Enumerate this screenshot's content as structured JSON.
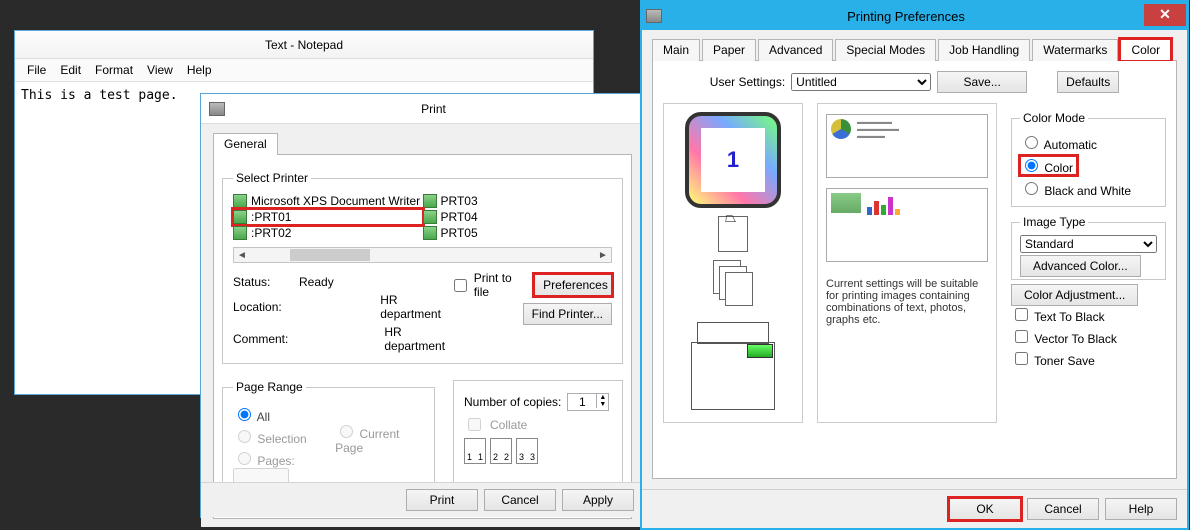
{
  "notepad": {
    "title": "Text - Notepad",
    "menu": {
      "file": "File",
      "edit": "Edit",
      "format": "Format",
      "view": "View",
      "help": "Help"
    },
    "body": "This is a test page."
  },
  "print": {
    "title": "Print",
    "tab_general": "General",
    "select_printer": "Select Printer",
    "printers": [
      "Microsoft XPS Document Writer",
      ":PRT01",
      ":PRT02",
      "PRT03",
      "PRT04",
      "PRT05"
    ],
    "status_label": "Status:",
    "status_value": "Ready",
    "location_label": "Location:",
    "location_value": "HR department",
    "comment_label": "Comment:",
    "comment_value": "HR department",
    "print_to_file": "Print to file",
    "preferences": "Preferences",
    "find_printer": "Find Printer...",
    "page_range": "Page Range",
    "all": "All",
    "selection": "Selection",
    "current_page": "Current Page",
    "pages": "Pages:",
    "copies_label": "Number of copies:",
    "copies_value": "1",
    "collate": "Collate",
    "btn_print": "Print",
    "btn_cancel": "Cancel",
    "btn_apply": "Apply"
  },
  "prefs": {
    "title": "Printing Preferences",
    "tabs": {
      "main": "Main",
      "paper": "Paper",
      "advanced": "Advanced",
      "special": "Special Modes",
      "job": "Job Handling",
      "watermarks": "Watermarks",
      "color": "Color"
    },
    "user_settings_label": "User Settings:",
    "user_settings_value": "Untitled",
    "save": "Save...",
    "defaults": "Defaults",
    "preview_number": "1",
    "desc": "Current settings will be suitable for printing images containing combinations of text, photos, graphs etc.",
    "color_mode": "Color Mode",
    "automatic": "Automatic",
    "color": "Color",
    "bw": "Black and White",
    "image_type": "Image Type",
    "image_type_value": "Standard",
    "advanced_color": "Advanced Color...",
    "color_adjustment": "Color Adjustment...",
    "text_to_black": "Text To Black",
    "vector_to_black": "Vector To Black",
    "toner_save": "Toner Save",
    "ok": "OK",
    "cancel": "Cancel",
    "help": "Help"
  }
}
